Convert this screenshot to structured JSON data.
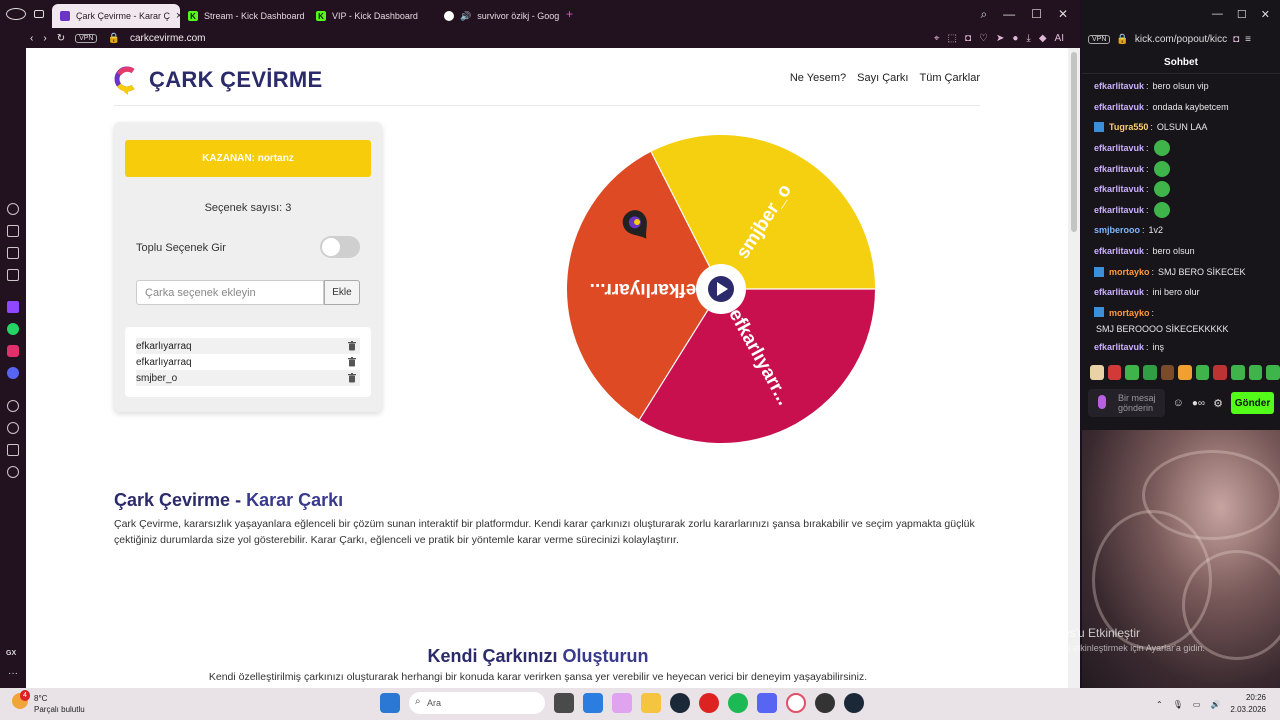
{
  "browser": {
    "tabs": [
      {
        "title": "Çark Çevirme - Karar Ç",
        "active": true
      },
      {
        "title": "Stream - Kick Dashboard",
        "active": false
      },
      {
        "title": "VIP - Kick Dashboard",
        "active": false
      },
      {
        "title": "survivor özikj - Goog",
        "active": false
      }
    ],
    "vpn_label": "VPN",
    "url": "carkcevirme.com",
    "ai_label": "AI"
  },
  "site": {
    "brand": "ÇARK ÇEVİRME",
    "nav": [
      "Ne Yesem?",
      "Sayı Çarkı",
      "Tüm Çarklar"
    ],
    "winner_label": "KAZANAN: nortanz",
    "option_count_label": "Seçenek sayısı: 3",
    "bulk_toggle_label": "Toplu Seçenek Gir",
    "add_input_placeholder": "Çarka seçenek ekleyin",
    "add_button": "Ekle",
    "options": [
      "efkarlıyarraq",
      "efkarlıyarraq",
      "smjber_o"
    ],
    "wheel_labels": [
      "smjber_o",
      "efkarlıyarr...",
      "efkarlıyarr..."
    ],
    "wheel_colors": [
      "#f5d010",
      "#c8104f",
      "#dd4a24"
    ],
    "section1_title_a": "Çark Çevirme",
    "section1_title_sep": " - ",
    "section1_title_b": "Karar Çarkı",
    "section1_text": "Çark Çevirme, kararsızlık yaşayanlara eğlenceli bir çözüm sunan interaktif bir platformdur. Kendi karar çarkınızı oluşturarak zorlu kararlarınızı şansa bırakabilir ve seçim yapmakta güçlük çektiğiniz durumlarda size yol gösterebilir. Karar Çarkı, eğlenceli ve pratik bir yöntemle karar verme sürecinizi kolaylaştırır.",
    "section2_title_a": "Kendi Çarkınızı",
    "section2_title_b": "Oluşturun",
    "section2_text": "Kendi özelleştirilmiş çarkınızı oluşturarak herhangi bir konuda karar verirken şansa yer verebilir ve heyecan verici bir deneyim yaşayabilirsiniz."
  },
  "chat": {
    "url": "kick.com/popout/kicc",
    "title": "Sohbet",
    "messages": [
      {
        "user": "efkarlitavuk",
        "text": "bero olsun vip",
        "color": "#c9b0ff"
      },
      {
        "user": "efkarlitavuk",
        "text": "ondada kaybetcem",
        "color": "#c9b0ff"
      },
      {
        "user": "Tugra550",
        "text": "OLSUN LAA",
        "color": "#f7d26b",
        "badge": true
      },
      {
        "user": "efkarlitavuk",
        "text": "",
        "color": "#c9b0ff",
        "emote": true
      },
      {
        "user": "efkarlitavuk",
        "text": "",
        "color": "#c9b0ff",
        "emote": true
      },
      {
        "user": "efkarlitavuk",
        "text": "",
        "color": "#c9b0ff",
        "emote": true
      },
      {
        "user": "efkarlitavuk",
        "text": "",
        "color": "#c9b0ff",
        "emote": true
      },
      {
        "user": "smjberooo",
        "text": "1v2",
        "color": "#7fb8ff"
      },
      {
        "user": "efkarlitavuk",
        "text": "bero olsun",
        "color": "#c9b0ff"
      },
      {
        "user": "mortayko",
        "text": "SMJ BERO SİKECEK",
        "color": "#ff9a3c",
        "badge": true
      },
      {
        "user": "efkarlitavuk",
        "text": "ini bero olur",
        "color": "#c9b0ff"
      },
      {
        "user": "mortayko",
        "text": "SMJ BEROOOO SİKECEKKKKK",
        "color": "#ff9a3c",
        "badge": true,
        "two": true
      },
      {
        "user": "efkarlitavuk",
        "text": "inş",
        "color": "#c9b0ff"
      }
    ],
    "input_placeholder": "Bir mesaj gönderin",
    "send_button": "Gönder"
  },
  "watermark": {
    "line1": "Windows'u Etkinleştir",
    "line2": "Windows'u etkinleştirmek için Ayarlar'a gidin."
  },
  "taskbar": {
    "temp": "8°C",
    "weather": "Parçalı bulutlu",
    "notif_count": "4",
    "search": "Ara",
    "time": "20:26",
    "date": "2.03.2026"
  }
}
